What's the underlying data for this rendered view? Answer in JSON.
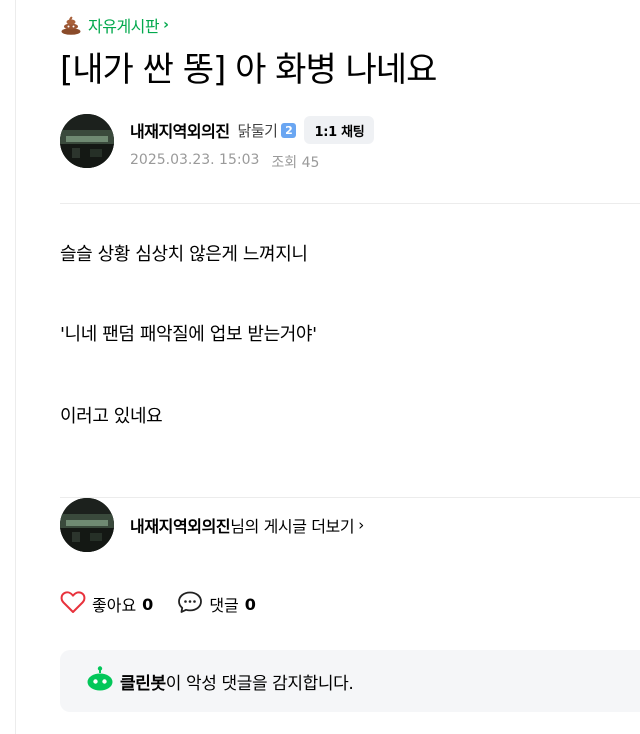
{
  "board": {
    "icon": "poo-icon",
    "name": "자유게시판",
    "chevron": "›"
  },
  "post": {
    "title": "[내가 싼 똥] 아 화병 나네요",
    "author": "내재지역외의진",
    "grade": "닭둘기",
    "level": "2",
    "chat_label": "1:1 채팅",
    "date": "2025.03.23. 15:03",
    "views": "조회 45",
    "body": [
      "슬슬 상황 심상치 않은게 느껴지니",
      "'니네 팬덤 패악질에 업보 받는거야'",
      "이러고 있네요"
    ]
  },
  "more": {
    "author": "내재지역외의진",
    "suffix": "님의 게시글 더보기",
    "chevron": "›"
  },
  "actions": {
    "like_label": "좋아요",
    "like_count": "0",
    "comment_label": "댓글",
    "comment_count": "0"
  },
  "cleanbot": {
    "brand": "클린봇",
    "text": "이 악성 댓글을 감지합니다."
  },
  "colors": {
    "accent": "#03a94d",
    "heart": "#e8323c",
    "level": "#6aa6f2"
  }
}
